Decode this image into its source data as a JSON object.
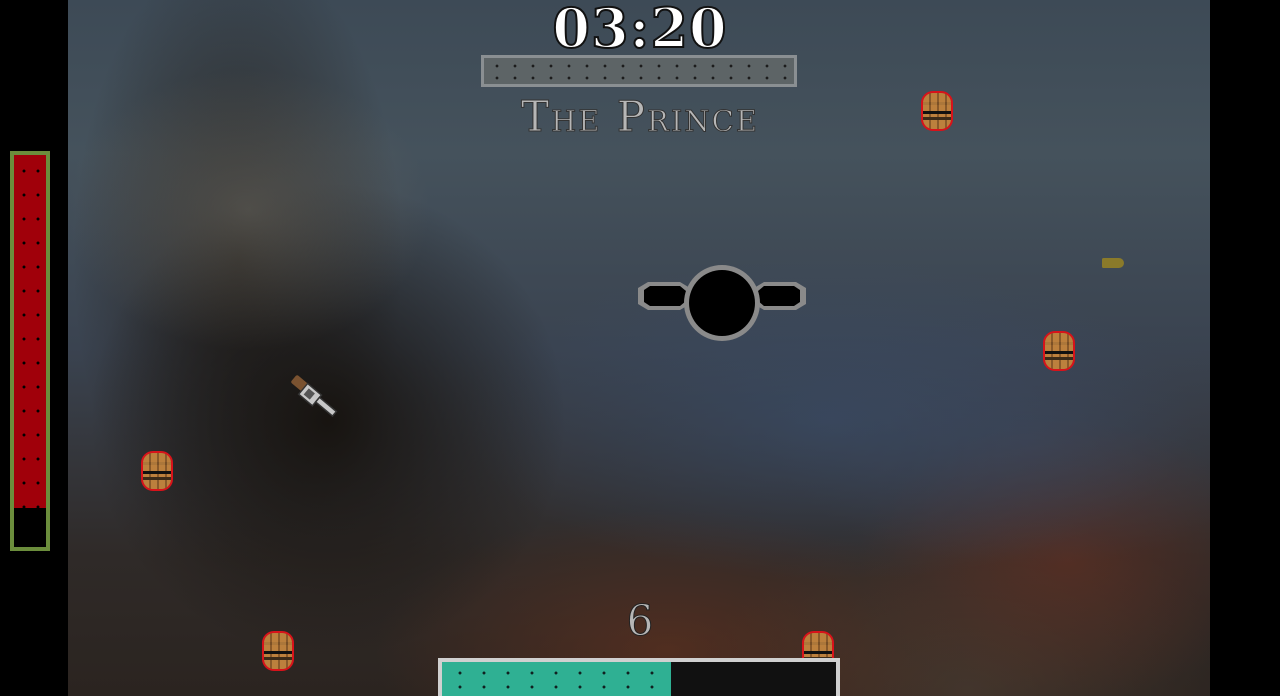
{
  "hud": {
    "timer": "03:20",
    "boss_name": "The Prince",
    "ammo_count": "6",
    "health_fraction": 0.9,
    "ammo_fraction": 0.58
  },
  "colors": {
    "health_fill": "#a0000a",
    "health_frame": "#6b8d3c",
    "ammo_fill": "#2fb093",
    "barrel_outline": "#d8121a"
  },
  "sprites": {
    "boss": "winged-black-orb",
    "player": "revolver",
    "projectile": "bullet",
    "obstacle": "barrel"
  }
}
